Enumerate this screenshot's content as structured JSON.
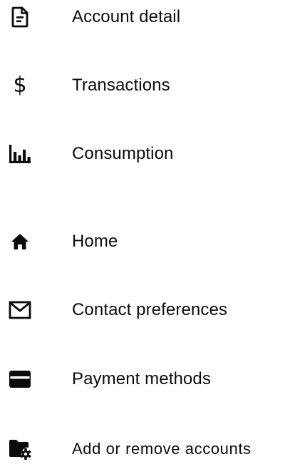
{
  "menu": {
    "items": [
      {
        "id": "account-detail",
        "label": "Account detail",
        "icon": "document-icon"
      },
      {
        "id": "transactions",
        "label": "Transactions",
        "icon": "dollar-icon",
        "glyph": "$"
      },
      {
        "id": "consumption",
        "label": "Consumption",
        "icon": "bar-chart-icon"
      },
      {
        "id": "home",
        "label": "Home",
        "icon": "home-icon"
      },
      {
        "id": "contact-preferences",
        "label": "Contact preferences",
        "icon": "mail-icon"
      },
      {
        "id": "payment-methods",
        "label": "Payment methods",
        "icon": "credit-card-icon"
      },
      {
        "id": "add-remove-accounts",
        "label": "Add or remove accounts",
        "icon": "folder-settings-icon"
      }
    ]
  },
  "colors": {
    "text": "#0b0b0b",
    "icon": "#0b0b0b",
    "background": "#ffffff"
  }
}
